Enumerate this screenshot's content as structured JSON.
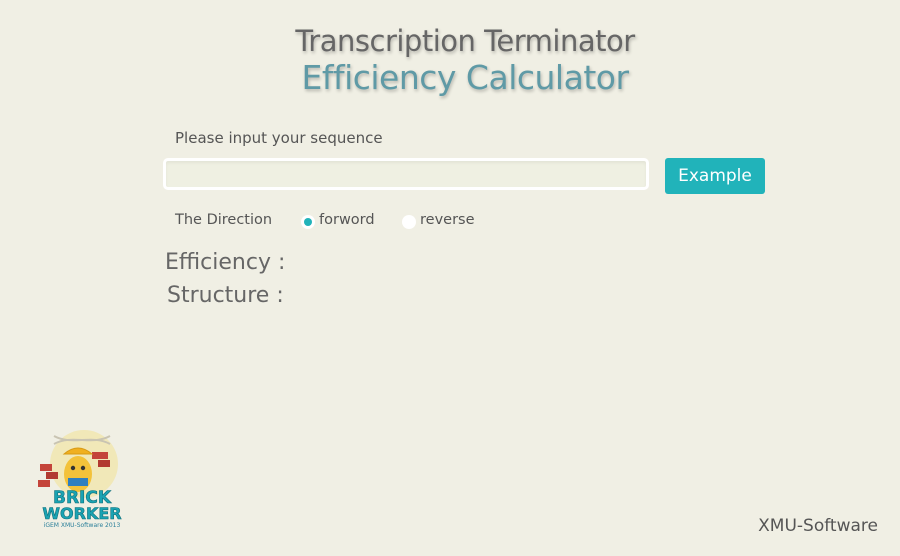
{
  "header": {
    "title_line1": "Transcription Terminator",
    "title_line2": "Efficiency Calculator"
  },
  "form": {
    "sequence_label": "Please input your sequence",
    "sequence_value": "",
    "example_button": "Example",
    "direction_label": "The Direction",
    "direction_options": [
      {
        "label": "forword",
        "checked": true
      },
      {
        "label": "reverse",
        "checked": false
      }
    ]
  },
  "results": {
    "efficiency_label": "Efficiency :",
    "structure_label": "Structure :"
  },
  "logo": {
    "line1": "BRICK",
    "line2": "WORKER",
    "caption": "iGEM XMU-Software 2013"
  },
  "footer": {
    "text": "XMU-Software"
  },
  "colors": {
    "background": "#f0efe4",
    "accent": "#21b3ba",
    "title_blue": "#5f9aa6"
  }
}
